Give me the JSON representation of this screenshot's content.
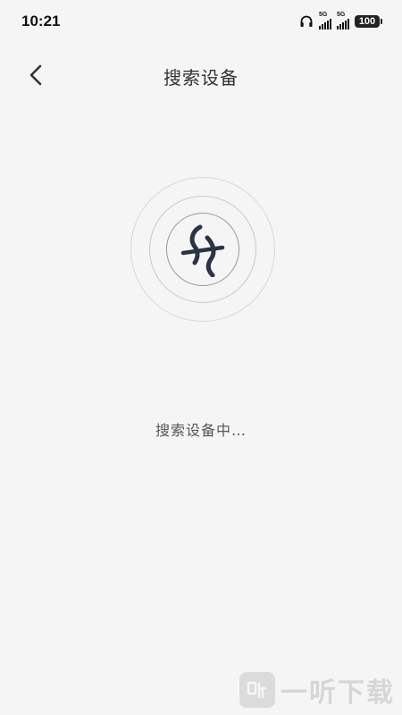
{
  "status_bar": {
    "time": "10:21",
    "signal_1_label": "5G",
    "signal_2_label": "5G",
    "battery_level": "100"
  },
  "header": {
    "title": "搜索设备"
  },
  "main": {
    "status_text": "搜索设备中…"
  },
  "watermark": {
    "text": "一听下载"
  },
  "colors": {
    "background": "#f5f5f5",
    "logo": "#2b3346",
    "ring": "#c9c9c9"
  },
  "icons": {
    "back": "chevron-left-icon",
    "logo": "brand-logo-icon",
    "headphone": "headphone-icon"
  }
}
